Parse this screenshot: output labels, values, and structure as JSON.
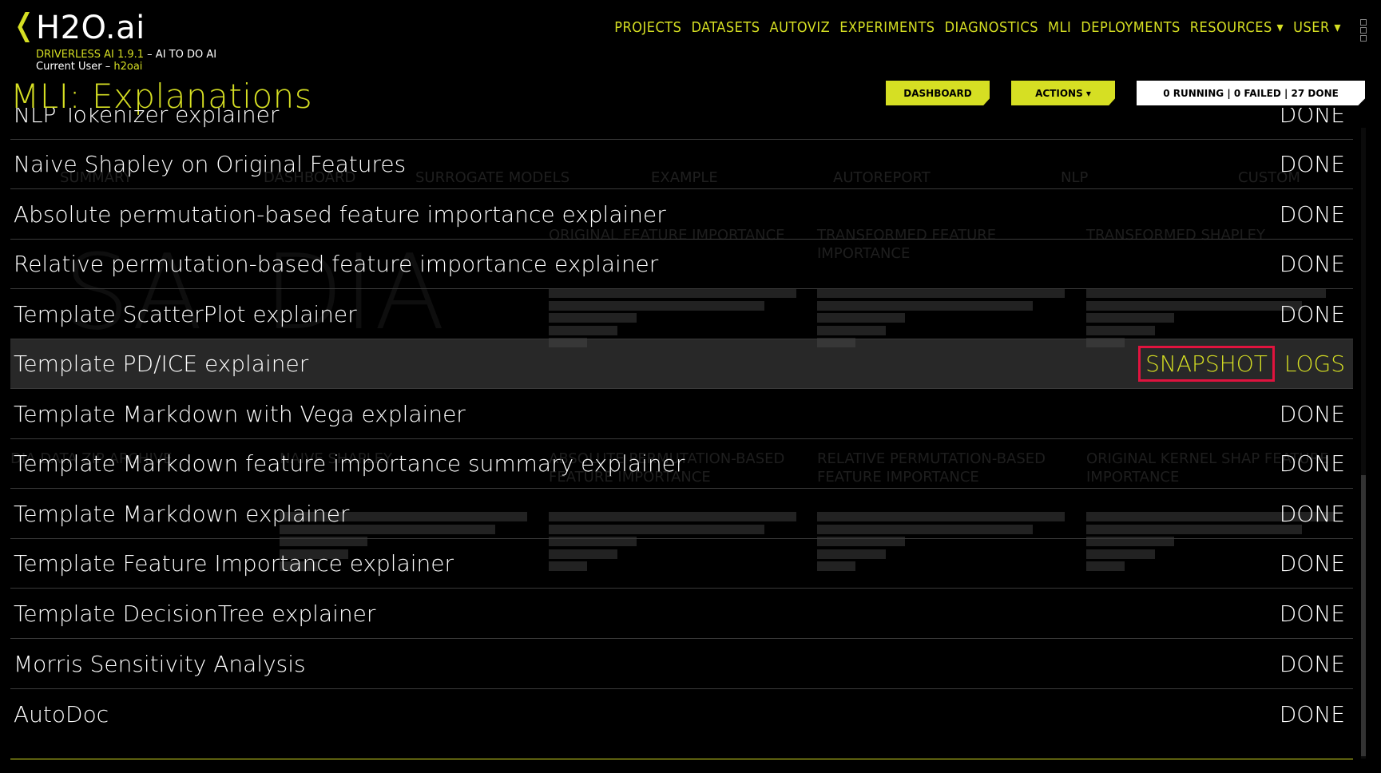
{
  "header": {
    "logo_chevron": "❬",
    "logo_text": "H2O.ai",
    "version": "DRIVERLESS AI 1.9.1",
    "tagline": " – AI TO DO AI",
    "current_user_label": "Current User – ",
    "current_user": "h2oai"
  },
  "nav": {
    "items": [
      "PROJECTS",
      "DATASETS",
      "AUTOVIZ",
      "EXPERIMENTS",
      "DIAGNOSTICS",
      "MLI",
      "DEPLOYMENTS",
      "RESOURCES ▾",
      "USER ▾"
    ]
  },
  "page_title": "MLI: Explanations",
  "toolbar": {
    "dashboard_label": "DASHBOARD",
    "actions_label": "ACTIONS ▾",
    "status_text": "0 RUNNING | 0 FAILED | 27 DONE"
  },
  "background": {
    "tabs": [
      "SUMMARY",
      "DASHBOARD",
      "SURROGATE MODELS",
      "EXAMPLE",
      "AUTOREPORT",
      "NLP",
      "CUSTOM"
    ],
    "big_letters": [
      "SA",
      "DIA"
    ],
    "cards_top": [
      "ORIGINAL FEATURE IMPORTANCE",
      "TRANSFORMED FEATURE IMPORTANCE",
      "TRANSFORMED SHAPLEY"
    ],
    "cards_bottom": [
      "DIA DATA ZIP ARCHIVE",
      "NAIVE SHAPLEY",
      "ABSOLUTE PERMUTATION-BASED FEATURE IMPORTANCE",
      "RELATIVE PERMUTATION-BASED FEATURE IMPORTANCE",
      "ORIGINAL KERNEL SHAP FEATURE IMPORTANCE"
    ]
  },
  "explainers": [
    {
      "name": "NLP Tokenizer explainer",
      "status": "DONE"
    },
    {
      "name": "Naive Shapley on Original Features",
      "status": "DONE"
    },
    {
      "name": "Absolute permutation-based feature importance explainer",
      "status": "DONE"
    },
    {
      "name": "Relative permutation-based feature importance explainer",
      "status": "DONE"
    },
    {
      "name": "Template ScatterPlot explainer",
      "status": "DONE"
    },
    {
      "name": "Template PD/ICE explainer",
      "status": "",
      "snapshot_label": "SNAPSHOT",
      "logs_label": "LOGS",
      "selected": true
    },
    {
      "name": "Template Markdown with Vega explainer",
      "status": "DONE"
    },
    {
      "name": "Template Markdown feature importance summary explainer",
      "status": "DONE"
    },
    {
      "name": "Template Markdown explainer",
      "status": "DONE"
    },
    {
      "name": "Template Feature Importance explainer",
      "status": "DONE"
    },
    {
      "name": "Template DecisionTree explainer",
      "status": "DONE"
    },
    {
      "name": "Morris Sensitivity Analysis",
      "status": "DONE"
    },
    {
      "name": "AutoDoc",
      "status": "DONE"
    }
  ],
  "colors": {
    "accent": "#d6df23",
    "highlight_border": "#e0133e",
    "background": "#000000"
  }
}
